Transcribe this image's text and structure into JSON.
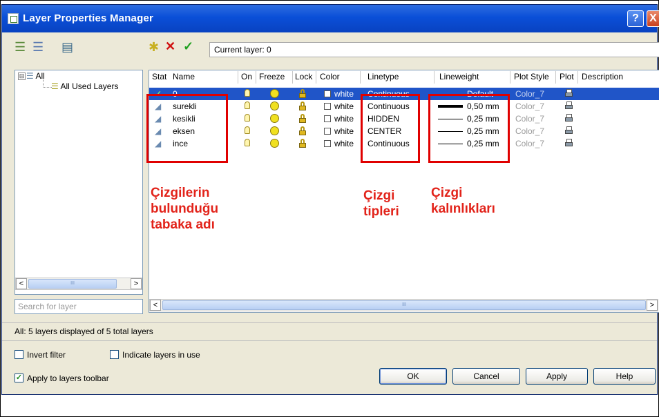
{
  "window": {
    "title": "Layer Properties Manager",
    "help_btn": "?",
    "close_btn": "X"
  },
  "toolbar": {
    "current_layer_label": "Current layer: 0"
  },
  "tree": {
    "expander": "⊟",
    "root": "All",
    "child": "All Used Layers"
  },
  "search": {
    "placeholder": "Search for layer"
  },
  "columns": {
    "status": "Stat",
    "name": "Name",
    "on": "On",
    "freeze": "Freeze",
    "lock": "Lock",
    "color": "Color",
    "linetype": "Linetype",
    "lineweight": "Lineweight",
    "plot_style": "Plot Style",
    "plot": "Plot",
    "description": "Description"
  },
  "layers": [
    {
      "status": "✓",
      "name": "0",
      "color": "white",
      "linetype": "Continuous",
      "lineweight": "Default",
      "plot_style": "Color_7",
      "selected": true
    },
    {
      "status": "",
      "name": "surekli",
      "color": "white",
      "linetype": "Continuous",
      "lineweight": "0,50 mm",
      "plot_style": "Color_7",
      "selected": false
    },
    {
      "status": "",
      "name": "kesikli",
      "color": "white",
      "linetype": "HIDDEN",
      "lineweight": "0,25 mm",
      "plot_style": "Color_7",
      "selected": false
    },
    {
      "status": "",
      "name": "eksen",
      "color": "white",
      "linetype": "CENTER",
      "lineweight": "0,25 mm",
      "plot_style": "Color_7",
      "selected": false
    },
    {
      "status": "",
      "name": "ince",
      "color": "white",
      "linetype": "Continuous",
      "lineweight": "0,25 mm",
      "plot_style": "Color_7",
      "selected": false
    }
  ],
  "status_line": "All: 5 layers displayed of 5 total layers",
  "options": {
    "invert_filter": {
      "label": "Invert filter",
      "checked": false
    },
    "indicate_layers": {
      "label": "Indicate layers in use",
      "checked": false
    },
    "apply_toolbar": {
      "label": "Apply to layers toolbar",
      "checked": true
    }
  },
  "buttons": {
    "ok": "OK",
    "cancel": "Cancel",
    "apply": "Apply",
    "help": "Help"
  },
  "annotations": {
    "layer_name": [
      "Çizgilerin",
      "bulunduğu",
      "tabaka adı"
    ],
    "linetype": [
      "Çizgi",
      "tipleri"
    ],
    "lineweight": [
      "Çizgi",
      "kalınlıkları"
    ]
  },
  "colors": {
    "title_bar": "#0a4fd8",
    "selection": "#2055c8",
    "annotation_red": "#e2231a",
    "dialog_bg": "#ece9d8"
  }
}
